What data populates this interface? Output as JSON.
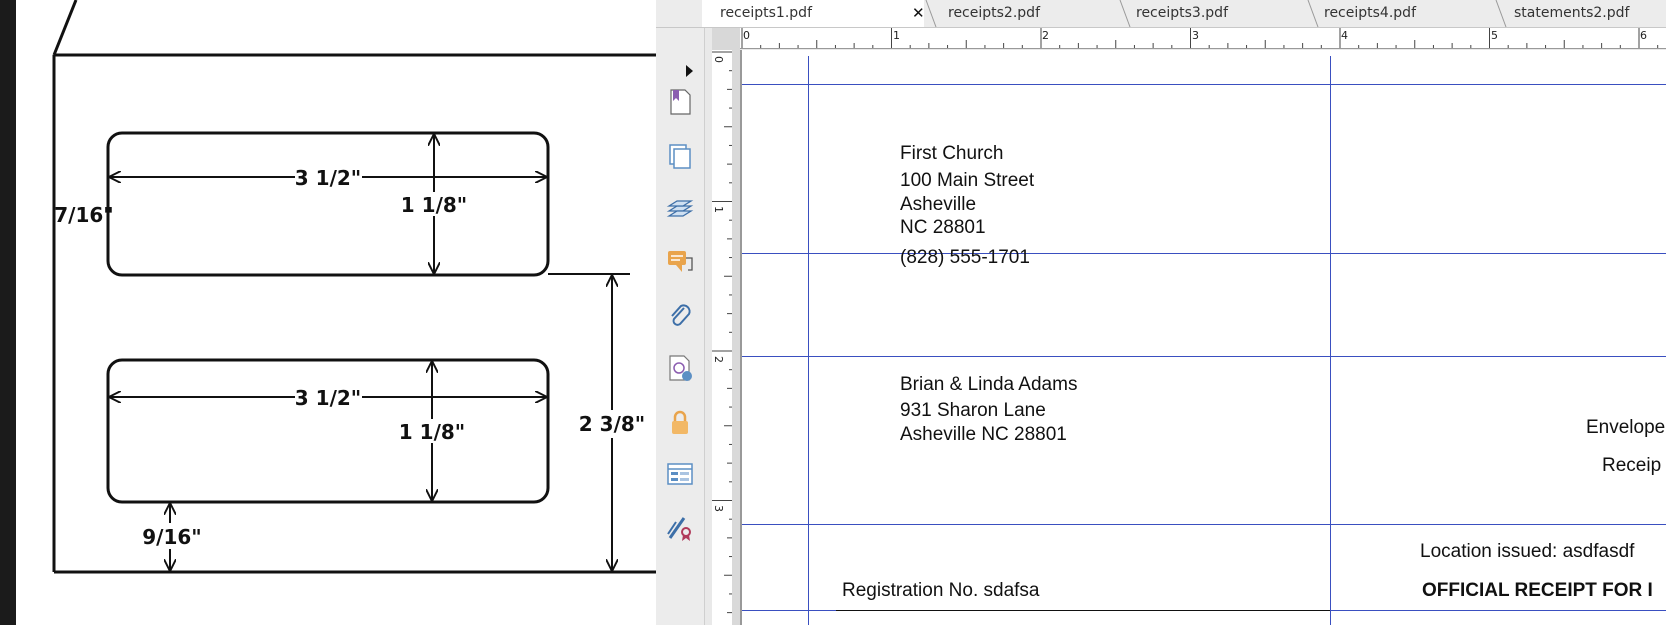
{
  "left_diagram": {
    "top_window_width": "3 1/2\"",
    "top_window_height": "1 1/8\"",
    "left_offset": "7/16\"",
    "bottom_window_width": "3 1/2\"",
    "bottom_window_height": "1 1/8\"",
    "window_spacing": "2 3/8\"",
    "bottom_offset": "9/16\""
  },
  "tabs": [
    {
      "label": "receipts1.pdf",
      "active": true,
      "close": "✕"
    },
    {
      "label": "receipts2.pdf",
      "active": false
    },
    {
      "label": "receipts3.pdf",
      "active": false
    },
    {
      "label": "receipts4.pdf",
      "active": false
    },
    {
      "label": "statements2.pdf",
      "active": false
    }
  ],
  "sidebar": {
    "icons": [
      "bookmark-icon",
      "pages-icon",
      "layers-icon",
      "comments-icon",
      "attachments-icon",
      "signature-icon",
      "lock-icon",
      "form-fields-icon",
      "certify-icon"
    ]
  },
  "ruler": {
    "horizontal_numbers": [
      "0",
      "1",
      "2",
      "3",
      "4",
      "5",
      "6"
    ],
    "vertical_numbers": [
      "0",
      "1",
      "2",
      "3"
    ]
  },
  "document": {
    "sender": {
      "name": "First Church",
      "street": "100 Main Street",
      "city": "Asheville",
      "state_zip": "NC  28801",
      "phone": "(828) 555-1701"
    },
    "recipient": {
      "name": "Brian & Linda Adams",
      "street": "931 Sharon Lane",
      "city_state_zip": "Asheville NC 28801"
    },
    "envelope_label": "Envelope",
    "receipt_label": "Receip",
    "location_issued": "Location issued: asdfasdf",
    "registration": "Registration No. sdafsa",
    "official_receipt": "OFFICIAL RECEIPT FOR I"
  },
  "colors": {
    "guide_blue": "#3a4fc0",
    "icon_purple": "#8b5db0",
    "icon_blue": "#5c8fc4",
    "icon_orange": "#e9a44c"
  }
}
